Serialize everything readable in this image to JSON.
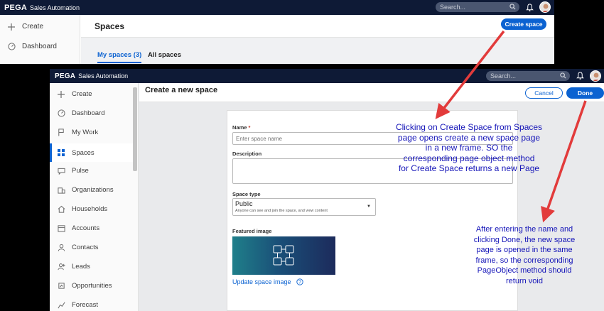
{
  "back_window": {
    "brand": "PEGA",
    "app_name": "Sales Automation",
    "search_placeholder": "Search...",
    "sidebar": [
      {
        "icon": "plus-icon",
        "label": "Create"
      },
      {
        "icon": "dashboard-icon",
        "label": "Dashboard"
      }
    ],
    "page_title": "Spaces",
    "create_space_button": "Create space",
    "tabs": [
      {
        "label": "My spaces (3)",
        "active": true
      },
      {
        "label": "All spaces",
        "active": false
      }
    ]
  },
  "front_window": {
    "brand": "PEGA",
    "app_name": "Sales Automation",
    "search_placeholder": "Search...",
    "sidebar": [
      {
        "icon": "plus-icon",
        "label": "Create"
      },
      {
        "icon": "dashboard-icon",
        "label": "Dashboard"
      },
      {
        "icon": "flag-icon",
        "label": "My Work"
      },
      {
        "icon": "grid-icon",
        "label": "Spaces",
        "active": true
      },
      {
        "icon": "pulse-icon",
        "label": "Pulse"
      },
      {
        "icon": "organization-icon",
        "label": "Organizations"
      },
      {
        "icon": "household-icon",
        "label": "Households"
      },
      {
        "icon": "accounts-icon",
        "label": "Accounts"
      },
      {
        "icon": "contacts-icon",
        "label": "Contacts"
      },
      {
        "icon": "leads-icon",
        "label": "Leads"
      },
      {
        "icon": "opportunities-icon",
        "label": "Opportunities"
      },
      {
        "icon": "forecast-icon",
        "label": "Forecast"
      }
    ],
    "page_title": "Create a new space",
    "cancel_button": "Cancel",
    "done_button": "Done",
    "form": {
      "name_label": "Name",
      "required_mark": "*",
      "name_placeholder": "Enter space name",
      "description_label": "Description",
      "space_type_label": "Space type",
      "space_type_value": "Public",
      "space_type_help": "Anyone can see and join the space, and view content",
      "featured_image_label": "Featured image",
      "update_image_link": "Update space image"
    }
  },
  "annotations": {
    "note1": [
      "Clicking on Create Space from Spaces",
      "page opens create a new space page",
      "in a new frame. SO the",
      "corresponding page object method",
      "for Create Space returns a new Page"
    ],
    "note2": [
      "After entering the name and",
      "clicking Done, the new space",
      "page is opened in the same",
      "frame, so the corresponding",
      "PageObject method should",
      "return void"
    ],
    "arrow_color": "#e23b3b",
    "text_color": "#1515b8"
  },
  "colors": {
    "header": "#0e1a36",
    "accent": "#0b62d1"
  }
}
